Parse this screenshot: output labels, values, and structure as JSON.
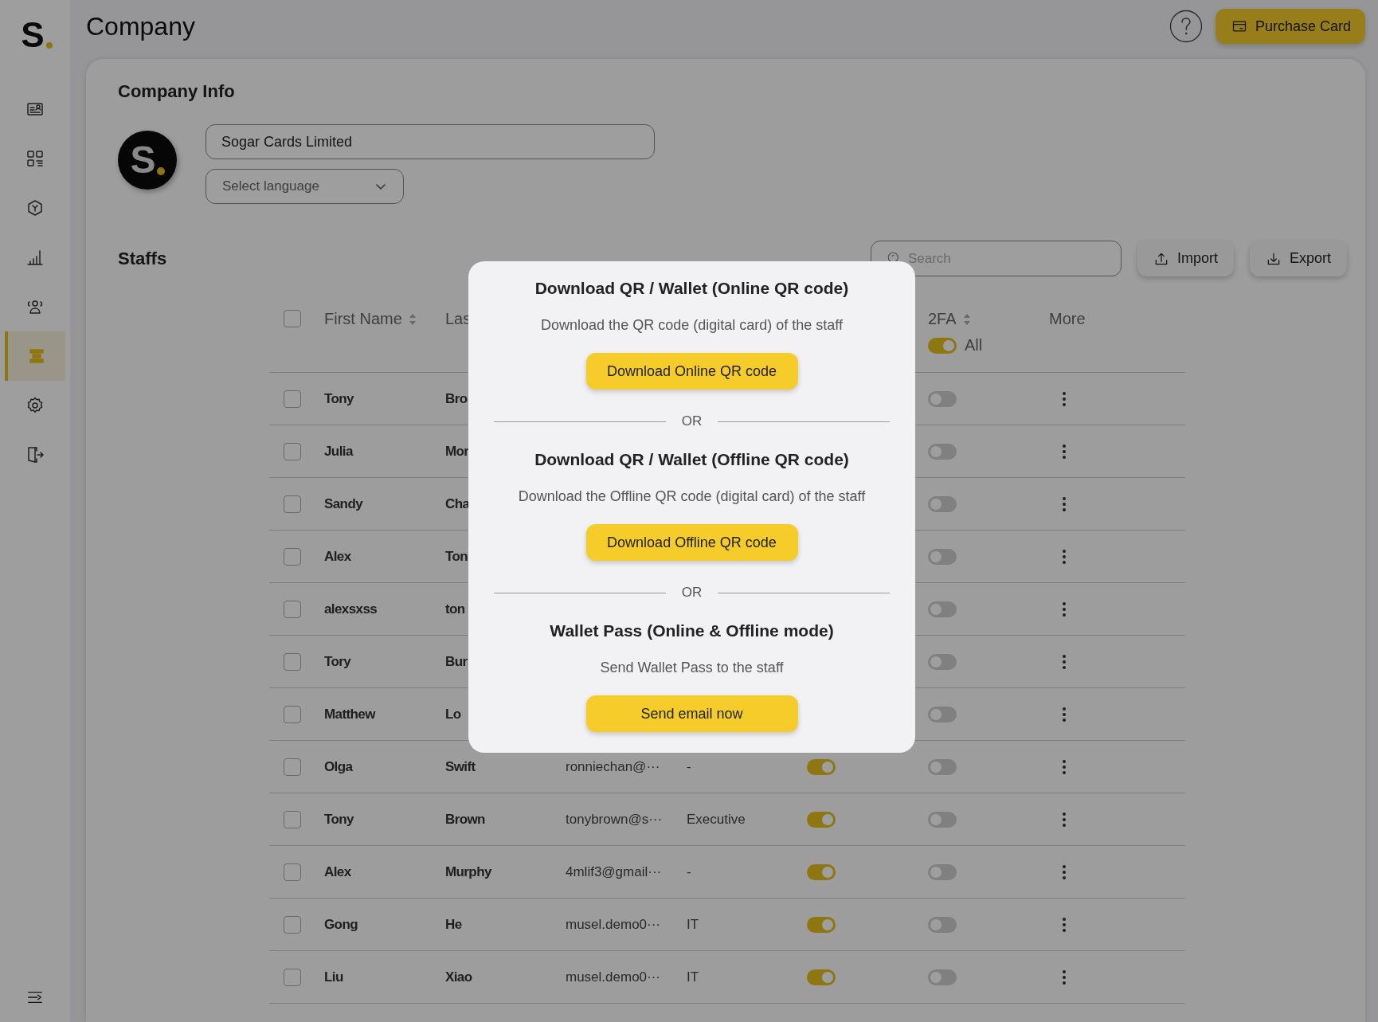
{
  "sidebar": {
    "logo": "S",
    "items": [
      {
        "selected": false
      },
      {
        "selected": false
      },
      {
        "selected": false
      },
      {
        "selected": false
      },
      {
        "selected": false
      },
      {
        "selected": true
      },
      {
        "selected": false
      },
      {
        "selected": false
      }
    ]
  },
  "header": {
    "title": "Company",
    "purchase_button": "Purchase Card"
  },
  "company_info": {
    "heading": "Company Info",
    "logo": "S",
    "name_value": "Sogar Cards Limited",
    "language_placeholder": "Select language"
  },
  "staffs": {
    "heading": "Staffs",
    "search_placeholder": "Search",
    "import_button": "Import",
    "export_button": "Export"
  },
  "table": {
    "header": {
      "all_checked": false,
      "first_name": {
        "label": "First Name",
        "sortable": true
      },
      "last_name": {
        "label": "Las"
      },
      "two_fa": {
        "label": "2FA",
        "sortable": true,
        "all_label": "All",
        "all_on": true
      },
      "more": {
        "label": "More"
      }
    },
    "rows": [
      {
        "checked": false,
        "first_name": "Tony",
        "last_name": "Bro",
        "two_fa": false
      },
      {
        "checked": false,
        "first_name": "Julia",
        "last_name": "Mor",
        "two_fa": false
      },
      {
        "checked": false,
        "first_name": "Sandy",
        "last_name": "Cha",
        "two_fa": false
      },
      {
        "checked": false,
        "first_name": "Alex",
        "last_name": "Ton",
        "two_fa": false
      },
      {
        "checked": false,
        "first_name": "alexsxss",
        "last_name": "ton",
        "two_fa": false
      },
      {
        "checked": false,
        "first_name": "Tory",
        "last_name": "Bur",
        "two_fa": false
      },
      {
        "checked": false,
        "first_name": "Matthew",
        "last_name": "Lo",
        "two_fa": false
      },
      {
        "checked": false,
        "first_name": "Olga",
        "last_name": "Swift",
        "email": "ronniechan@···",
        "role": "-",
        "active": true,
        "two_fa": false
      },
      {
        "checked": false,
        "first_name": "Tony",
        "last_name": "Brown",
        "email": "tonybrown@s···",
        "role": "Executive",
        "active": true,
        "two_fa": false
      },
      {
        "checked": false,
        "first_name": "Alex",
        "last_name": "Murphy",
        "email": "4mlif3@gmail···",
        "role": "-",
        "active": true,
        "two_fa": false
      },
      {
        "checked": false,
        "first_name": "Gong",
        "last_name": "He",
        "email": "musel.demo0···",
        "role": "IT",
        "active": true,
        "two_fa": false
      },
      {
        "checked": false,
        "first_name": "Liu",
        "last_name": "Xiao",
        "email": "musel.demo0···",
        "role": "IT",
        "active": true,
        "two_fa": false
      }
    ]
  },
  "modal": {
    "sections": [
      {
        "title": "Download QR / Wallet (Online QR code)",
        "description": "Download the QR code (digital card) of the staff",
        "button": "Download Online QR code"
      },
      {
        "divider_label": "OR",
        "title": "Download QR / Wallet (Offline QR code)",
        "description": "Download the Offline QR code (digital card) of the staff",
        "button": "Download Offline QR code"
      },
      {
        "divider_label": "OR",
        "title": "Wallet Pass (Online & Offline mode)",
        "description": "Send Wallet Pass to the staff",
        "button": "Send email now"
      }
    ]
  }
}
